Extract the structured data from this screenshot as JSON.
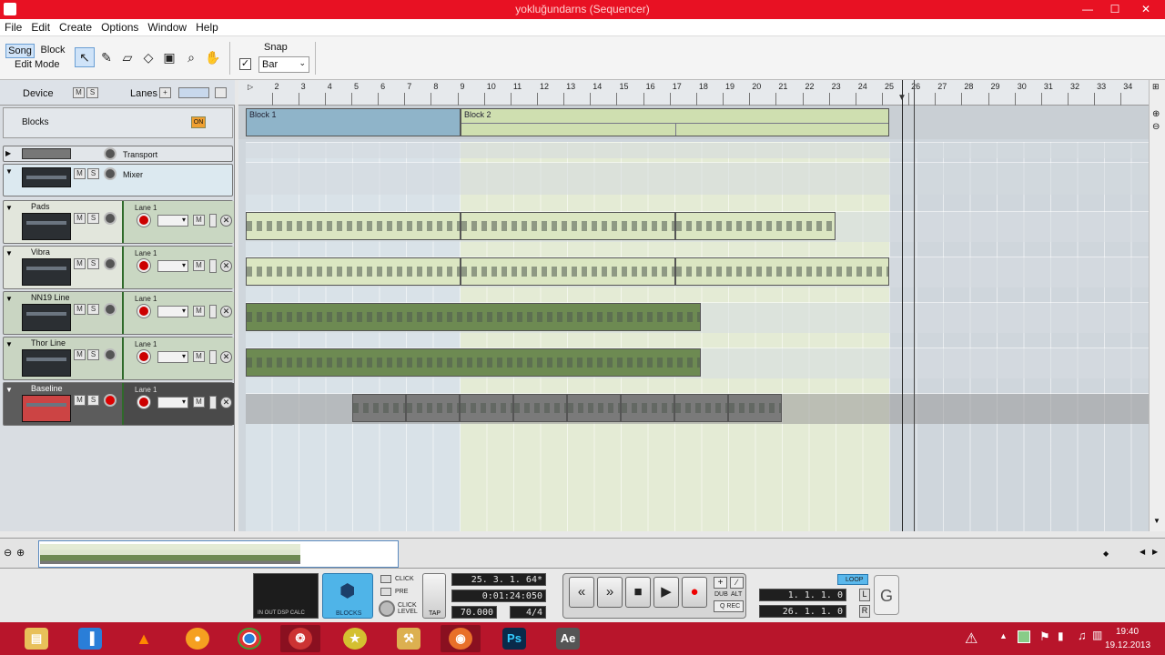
{
  "window": {
    "title": "yokluğundarns (Sequencer)",
    "minimize": "—",
    "maximize": "☐",
    "close": "✕"
  },
  "menu": [
    "File",
    "Edit",
    "Create",
    "Options",
    "Window",
    "Help"
  ],
  "toolbar": {
    "song_label": "Song",
    "block_label": "Block",
    "edit_mode_label": "Edit Mode",
    "snap_label": "Snap",
    "snap_value": "Bar",
    "snap_checked": true
  },
  "left_header": {
    "device_label": "Device",
    "lanes_label": "Lanes",
    "m": "M",
    "s": "S"
  },
  "blocks_row": {
    "label": "Blocks",
    "on_badge": "ON"
  },
  "tracks": [
    {
      "name": "Transport",
      "lane": ""
    },
    {
      "name": "Mixer",
      "lane": ""
    },
    {
      "name": "Pads",
      "lane": "Lane 1"
    },
    {
      "name": "Vibra",
      "lane": "Lane 1"
    },
    {
      "name": "NN19 Line",
      "lane": "Lane 1"
    },
    {
      "name": "Thor Line",
      "lane": "Lane 1"
    },
    {
      "name": "Baseline",
      "lane": "Lane 1"
    }
  ],
  "ruler_bars": [
    "2",
    "3",
    "4",
    "5",
    "6",
    "7",
    "8",
    "9",
    "10",
    "11",
    "12",
    "13",
    "14",
    "15",
    "16",
    "17",
    "18",
    "19",
    "20",
    "21",
    "22",
    "23",
    "24",
    "25",
    "26",
    "27",
    "28",
    "29",
    "30",
    "31",
    "32",
    "33",
    "34"
  ],
  "blocks": [
    {
      "label": "Block 1"
    },
    {
      "label": "Block 2"
    }
  ],
  "transport": {
    "position": "25. 3. 1. 64*",
    "time": "0:01:24:050",
    "tempo": "70.000",
    "signature": "4/4",
    "click_label": "CLICK",
    "pre_label": "PRE",
    "click_level_label": "CLICK LEVEL",
    "tap_label": "TAP",
    "blocks_label": "BLOCKS",
    "dub_label": "DUB",
    "alt_label": "ALT",
    "qrec_label": "Q REC",
    "loop_label": "LOOP",
    "loop_start": "1. 1. 1. 0",
    "loop_end": "26. 1. 1. 0",
    "l_label": "L",
    "r_label": "R",
    "in_out_label": "IN OUT DSP CALC"
  },
  "taskbar": {
    "time": "19:40",
    "date": "19.12.2013",
    "ps_label": "Ps",
    "ae_label": "Ae"
  },
  "colors": {
    "titlebar": "#e81123",
    "block1": "#8fb4c9",
    "block2": "#cfdfb0",
    "taskbar": "#b8152b"
  }
}
